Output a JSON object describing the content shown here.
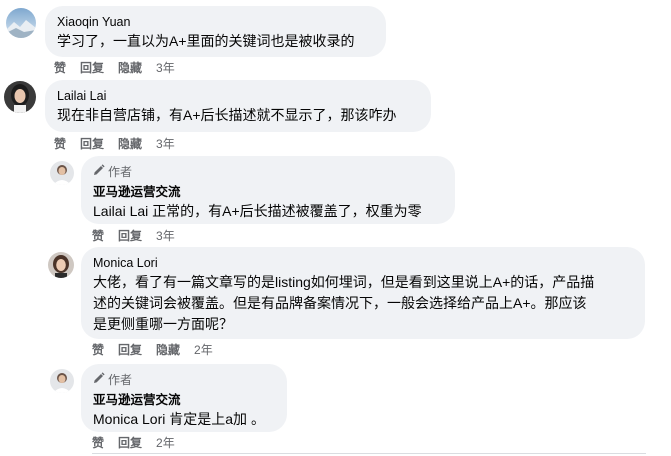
{
  "comments": [
    {
      "author": "Xiaoqin Yuan",
      "text": "学习了，一直以为A+里面的关键词也是被收录的",
      "actions": [
        "赞",
        "回复",
        "隐藏"
      ],
      "time": "3年"
    },
    {
      "author": "Lailai Lai",
      "text": "现在非自营店铺，有A+后长描述就不显示了，那该咋办",
      "actions": [
        "赞",
        "回复",
        "隐藏"
      ],
      "time": "3年"
    },
    {
      "badge": "作者",
      "author": "亚马逊运营交流",
      "mention": "Lailai Lai",
      "text": " 正常的，有A+后长描述被覆盖了，权重为零",
      "actions": [
        "赞",
        "回复"
      ],
      "time": "3年"
    },
    {
      "author": "Monica Lori",
      "text_lines": [
        "大佬，看了有一篇文章写的是listing如何埋词，但是看到这里说上A+的话，产品描",
        "述的关键词会被覆盖。但是有品牌备案情况下，一般会选择给产品上A+。那应该",
        "是更侧重哪一方面呢？"
      ],
      "actions": [
        "赞",
        "回复",
        "隐藏"
      ],
      "time": "2年"
    },
    {
      "badge": "作者",
      "author": "亚马逊运营交流",
      "mention": "Monica Lori",
      "text": " 肯定是上a加 。",
      "actions": [
        "赞",
        "回复"
      ],
      "time": "2年"
    }
  ],
  "icons": {
    "badge_icon": "pencil-icon"
  }
}
